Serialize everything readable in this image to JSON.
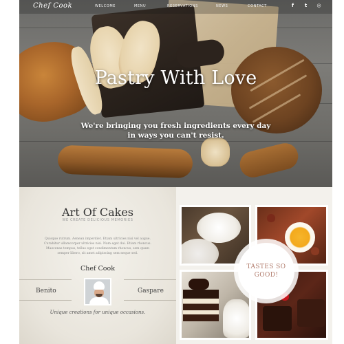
{
  "header": {
    "logo": "Chef Cook",
    "nav": [
      "WELCOME",
      "MENU",
      "RESERVATIONS",
      "NEWS",
      "CONTACT"
    ],
    "social_icons": [
      "facebook-icon",
      "twitter-icon",
      "instagram-icon"
    ],
    "social_glyphs": [
      "f",
      "t",
      "◎"
    ]
  },
  "hero": {
    "title": "Pastry With Love",
    "subtitle_line1": "We're bringing you fresh ingredients every day",
    "subtitle_line2": "in ways you can't resist."
  },
  "about": {
    "title": "Art Of Cakes",
    "subtitle": "WE CREATE DELICIOUS MEMORIES",
    "body": "Quisque rutrum. Aenean imperdiet. Etiam ultricies nisi vel augue. Curabitur ullamcorper ultricies nisi. Nam eget dui. Etiam rhoncus. Maecenas tempus, tellus eget condimentum rhoncus, sem quam semper libero, sit amet adipiscing sem neque sed.",
    "chef_title": "Chef Cook",
    "chef_left": "Benito",
    "chef_right": "Gaspare",
    "quote": "Unique creations for unique occasions."
  },
  "gallery": {
    "badge": "TASTES SO GOOD!"
  },
  "colors": {
    "section_bg": "#ebe7df",
    "badge_text": "#b07a6a",
    "tile_border": "#ffffff"
  }
}
